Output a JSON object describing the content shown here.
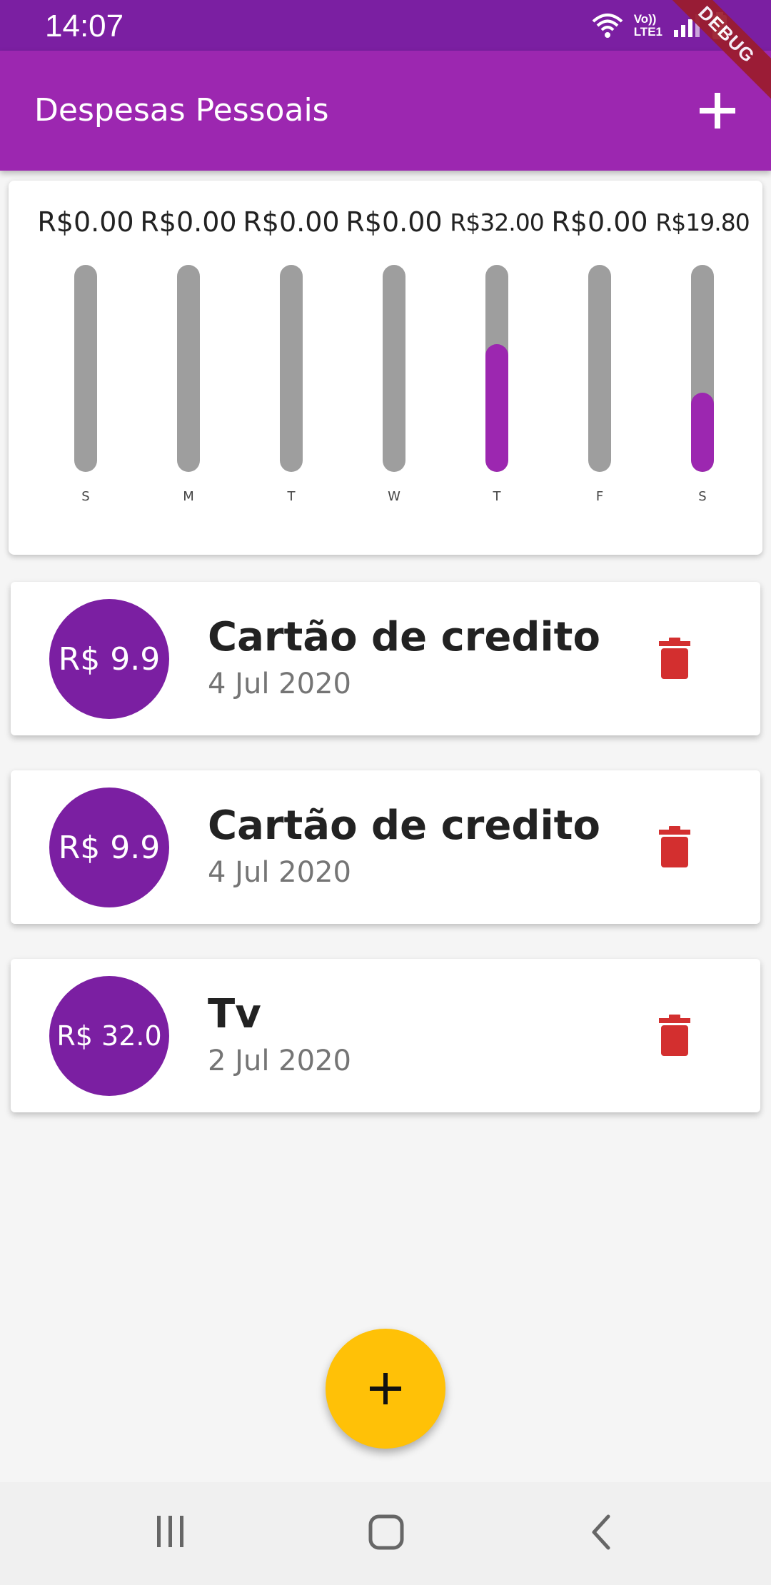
{
  "status_bar": {
    "time": "14:07",
    "lte_label": "Vo)) LTE1",
    "icons": [
      "wifi-icon",
      "signal-icon",
      "battery-icon"
    ]
  },
  "debug_banner": "DEBUG",
  "app_bar": {
    "title": "Despesas Pessoais",
    "add_icon": "plus-icon"
  },
  "chart_data": {
    "type": "bar",
    "categories": [
      "S",
      "M",
      "T",
      "W",
      "T",
      "F",
      "S"
    ],
    "value_labels": [
      "R$0.00",
      "R$0.00",
      "R$0.00",
      "R$0.00",
      "R$32.00",
      "R$0.00",
      "R$19.80"
    ],
    "values": [
      0,
      0,
      0,
      0,
      32.0,
      0,
      19.8
    ],
    "fill_fraction": [
      0,
      0,
      0,
      0,
      0.618,
      0,
      0.382
    ],
    "colors": {
      "track": "#9e9e9e",
      "fill": "#9c27b0"
    }
  },
  "transactions": [
    {
      "amount": "R$ 9.9",
      "title": "Cartão de credito",
      "date": "4 Jul 2020",
      "delete_icon": "trash-icon"
    },
    {
      "amount": "R$ 9.9",
      "title": "Cartão de credito",
      "date": "4 Jul 2020",
      "delete_icon": "trash-icon"
    },
    {
      "amount": "R$ 32.0",
      "title": "Tv",
      "date": "2 Jul 2020",
      "delete_icon": "trash-icon"
    }
  ],
  "fab": {
    "icon": "plus-icon"
  },
  "nav_bar": {
    "icons": [
      "recent-apps-icon",
      "home-icon",
      "back-icon"
    ]
  },
  "colors": {
    "primary": "#9c27b0",
    "primary_dark": "#7b1fa2",
    "accent": "#ffc107",
    "delete": "#d32f2f"
  }
}
